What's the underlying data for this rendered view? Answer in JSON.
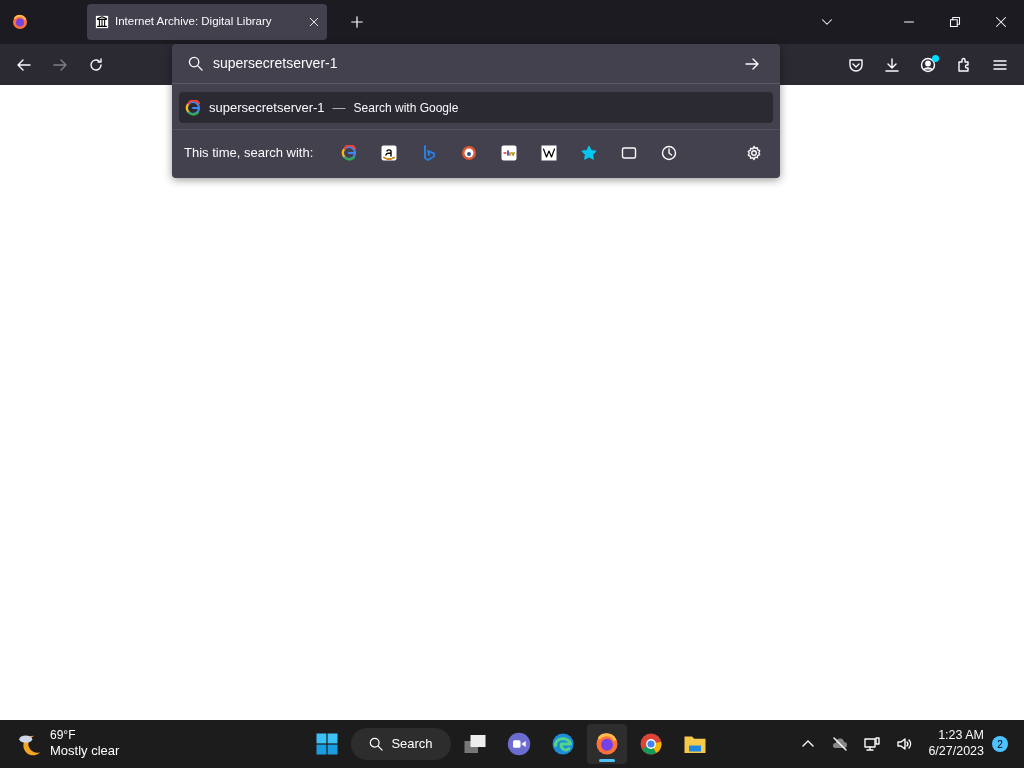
{
  "tabs": [
    {
      "title": "Internet Archive: Digital Library",
      "selected": true
    }
  ],
  "nav_buttons": [
    {
      "kind": "back",
      "disabled": false
    },
    {
      "kind": "forward",
      "disabled": true
    },
    {
      "kind": "reload",
      "disabled": false
    }
  ],
  "toolbar_buttons": [
    {
      "kind": "pocket"
    },
    {
      "kind": "download"
    },
    {
      "kind": "account",
      "notification": true
    },
    {
      "kind": "extensions"
    },
    {
      "kind": "menu"
    }
  ],
  "address_bar": {
    "value": "supersecretserver-1"
  },
  "suggestions": [
    {
      "query": "supersecretserver-1",
      "separator": "—",
      "action": "Search with Google",
      "selected": true
    }
  ],
  "one_offs": {
    "label": "This time, search with:",
    "engines": [
      {
        "kind": "google"
      },
      {
        "kind": "amazon"
      },
      {
        "kind": "bing"
      },
      {
        "kind": "duckduckgo"
      },
      {
        "kind": "ebay"
      },
      {
        "kind": "wikipedia"
      },
      {
        "kind": "bookmarks"
      },
      {
        "kind": "tabs"
      },
      {
        "kind": "history"
      }
    ]
  },
  "taskbar": {
    "weather": {
      "temperature": "69°F",
      "condition": "Mostly clear"
    },
    "search_label": "Search",
    "apps": [
      {
        "kind": "taskview",
        "selected": false
      },
      {
        "kind": "teams",
        "selected": false
      },
      {
        "kind": "edge",
        "selected": false
      },
      {
        "kind": "firefox",
        "selected": true
      },
      {
        "kind": "chrome",
        "selected": false
      },
      {
        "kind": "explorer",
        "selected": false
      }
    ],
    "clock": {
      "time": "1:23 AM",
      "date": "6/27/2023"
    },
    "notification_count": "2"
  }
}
